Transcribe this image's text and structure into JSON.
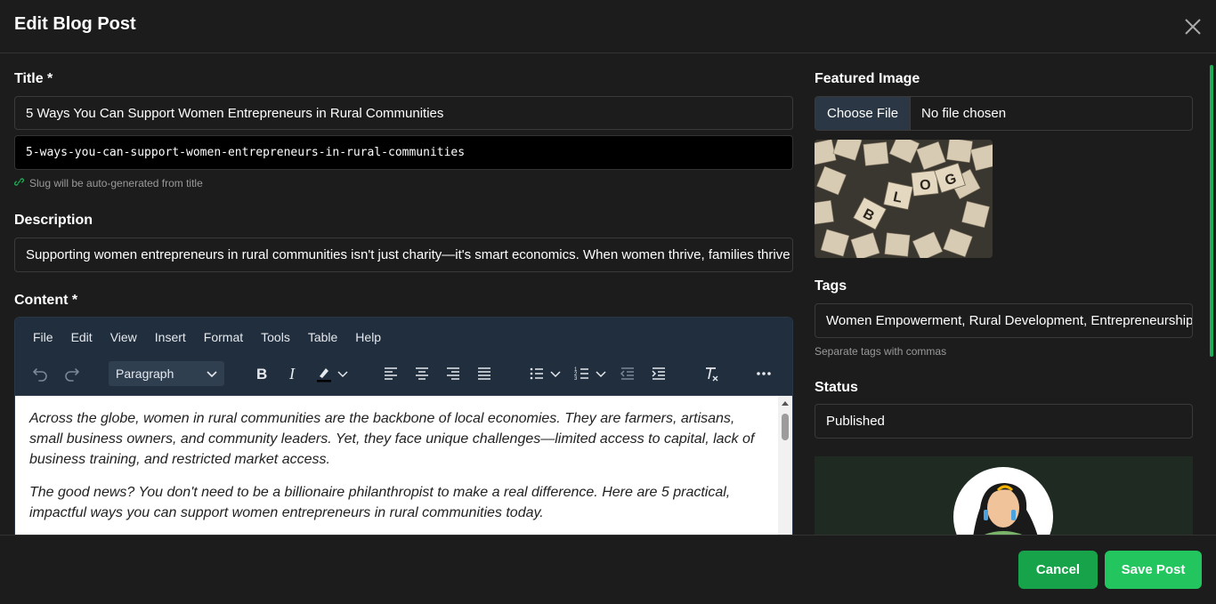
{
  "modal": {
    "title": "Edit Blog Post"
  },
  "form": {
    "title_label": "Title *",
    "title_value": "5 Ways You Can Support Women Entrepreneurs in Rural Communities",
    "slug_value": "5-ways-you-can-support-women-entrepreneurs-in-rural-communities",
    "slug_hint": "Slug will be auto-generated from title",
    "description_label": "Description",
    "description_value": "Supporting women entrepreneurs in rural communities isn't just charity—it's smart economics. When women thrive, families thrive",
    "content_label": "Content *"
  },
  "editor": {
    "menu": [
      "File",
      "Edit",
      "View",
      "Insert",
      "Format",
      "Tools",
      "Table",
      "Help"
    ],
    "block_format": "Paragraph",
    "paragraphs": [
      "Across the globe, women in rural communities are the backbone of local economies. They are farmers, artisans, small business owners, and community leaders. Yet, they face unique challenges—limited access to capital, lack of business training, and restricted market access.",
      "The good news? You don't need to be a billionaire philanthropist to make a real difference. Here are 5 practical, impactful ways you can support women entrepreneurs in rural communities today."
    ]
  },
  "sidebar": {
    "featured_label": "Featured Image",
    "choose_file": "Choose File",
    "no_file": "No file chosen",
    "image_tiles": [
      "B",
      "L",
      "O",
      "G"
    ],
    "tags_label": "Tags",
    "tags_value": "Women Empowerment, Rural Development, Entrepreneurship",
    "tags_hint": "Separate tags with commas",
    "status_label": "Status",
    "status_value": "Published"
  },
  "footer": {
    "cancel": "Cancel",
    "save": "Save Post"
  },
  "colors": {
    "accent": "#22c55e",
    "accent_dark": "#16a34a",
    "toolbar": "#202e3d",
    "background": "#1c1c1c"
  }
}
